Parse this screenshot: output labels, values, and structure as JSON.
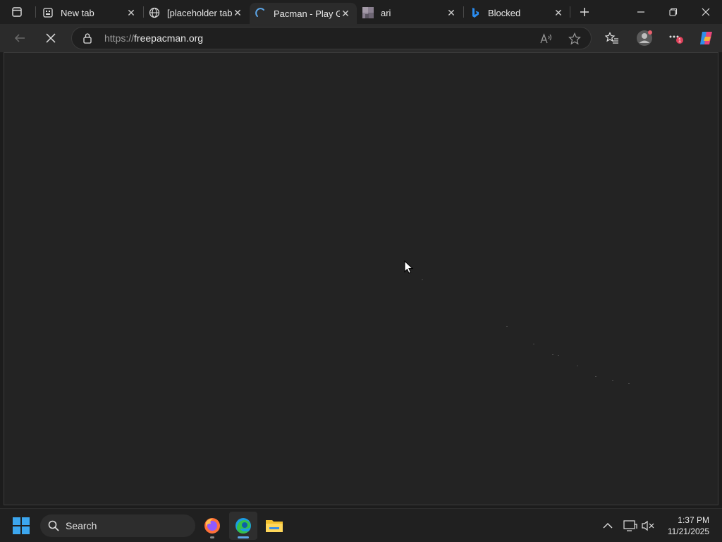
{
  "tabs": [
    {
      "title": "New tab",
      "favicon": "new-tab-icon"
    },
    {
      "title": "[placeholder tab title]",
      "favicon": "globe-icon"
    },
    {
      "title": "Pacman - Play Ga",
      "favicon": "loading-spinner-icon",
      "active": true
    },
    {
      "title": "ari",
      "favicon": "image-thumbnail-icon"
    },
    {
      "title": "Blocked",
      "favicon": "bing-icon"
    }
  ],
  "address": {
    "protocol": "https://",
    "host": "freepacman.org"
  },
  "taskbar": {
    "search_placeholder": "Search",
    "time": "1:37 PM",
    "date": "11/21/2025"
  },
  "notification_badge": "1",
  "colors": {
    "accent": "#5ca6e8",
    "page_bg": "#232323",
    "chrome_bg": "#1f1f1f",
    "toolbar_bg": "#2b2b2b"
  }
}
